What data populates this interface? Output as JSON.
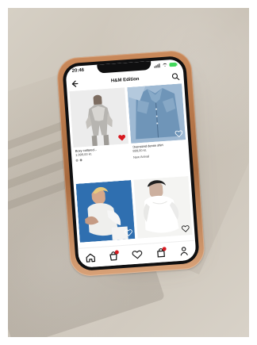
{
  "statusbar": {
    "time": "20:46",
    "signal_icon": "signal-icon",
    "wifi_icon": "wifi-icon",
    "battery_icon": "battery-icon"
  },
  "header": {
    "title": "H&M Edition",
    "back_icon": "back-arrow-icon",
    "search_icon": "search-icon"
  },
  "products": [
    {
      "name": "Boxy collared...",
      "price": "1.999,00 kr.",
      "swatch_colors": [
        "#ffffff",
        "#111111"
      ],
      "favorite_color": "#d71920"
    },
    {
      "name": "Oversized denim shirt",
      "price": "899,00 kr.",
      "label": "New Arrival",
      "favorite_color": "#ffffff"
    },
    {
      "favorite_color": "#ffffff"
    },
    {
      "favorite_color": "#ffffff"
    }
  ],
  "bottom_nav": {
    "items": [
      {
        "icon": "home-icon"
      },
      {
        "icon": "shopping-bag-icon",
        "badge": true
      },
      {
        "icon": "heart-icon"
      },
      {
        "icon": "bag-icon",
        "badge": true
      },
      {
        "icon": "profile-icon"
      }
    ],
    "accent_color": "#d71920"
  },
  "colors": {
    "accent": "#d71920",
    "surface": "#d8d2c8",
    "phone_frame": "#b77b4c"
  }
}
